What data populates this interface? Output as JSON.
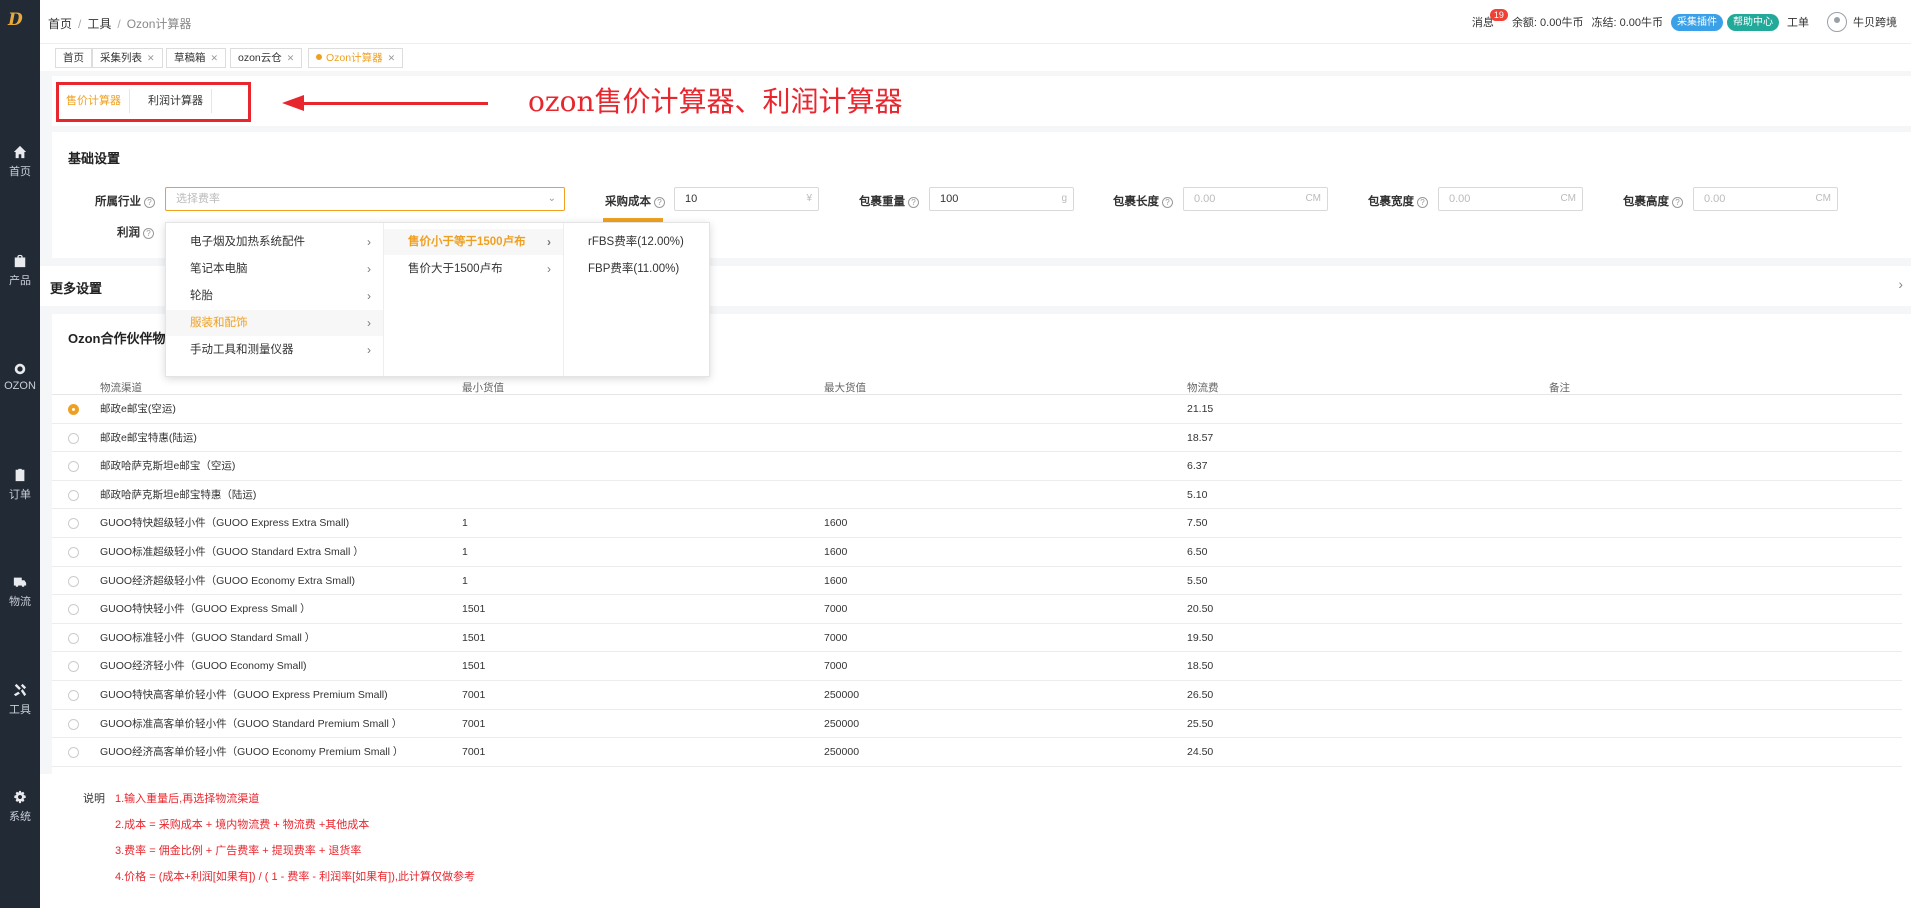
{
  "sidebar": {
    "logo": "D",
    "items": [
      {
        "label": "首页",
        "icon": "home-icon"
      },
      {
        "label": "产品",
        "icon": "bag-icon"
      },
      {
        "label": "OZON",
        "icon": "ozon-icon"
      },
      {
        "label": "订单",
        "icon": "clipboard-icon"
      },
      {
        "label": "物流",
        "icon": "truck-icon"
      },
      {
        "label": "工具",
        "icon": "tools-icon"
      },
      {
        "label": "系统",
        "icon": "gear-icon"
      }
    ]
  },
  "topbar": {
    "breadcrumb": [
      "首页",
      "工具",
      "Ozon计算器"
    ],
    "messages_label": "消息",
    "messages_count": "19",
    "balance": "余额: 0.00牛币",
    "frozen": "冻结: 0.00牛币",
    "plugin_btn": "采集插件",
    "help_btn": "帮助中心",
    "ticket": "工单",
    "username": "牛贝跨境"
  },
  "page_tabs": [
    {
      "label": "首页",
      "closable": false
    },
    {
      "label": "采集列表",
      "closable": true
    },
    {
      "label": "草稿箱",
      "closable": true
    },
    {
      "label": "ozon云仓",
      "closable": true
    },
    {
      "label": "Ozon计算器",
      "closable": true,
      "active": true
    }
  ],
  "sub_tabs": [
    "售价计算器",
    "利润计算器"
  ],
  "annotation": "ozon售价计算器、利润计算器",
  "basic": {
    "title": "基础设置",
    "industry_label": "所属行业",
    "industry_placeholder": "选择费率",
    "purchase_label": "采购成本",
    "purchase_value": "10",
    "purchase_unit": "¥",
    "weight_label": "包裹重量",
    "weight_value": "100",
    "weight_unit": "g",
    "length_label": "包裹长度",
    "length_placeholder": "0.00",
    "width_label": "包裹宽度",
    "width_placeholder": "0.00",
    "height_label": "包裹高度",
    "height_placeholder": "0.00",
    "dim_unit": "CM",
    "profit_label": "利润"
  },
  "cascader": {
    "col1": [
      "电子烟及加热系统配件",
      "笔记本电脑",
      "轮胎",
      "服装和配饰",
      "手动工具和测量仪器"
    ],
    "col1_selected": 3,
    "col2": [
      "售价小于等于1500卢布",
      "售价大于1500卢布"
    ],
    "col2_selected": 0,
    "col3": [
      "rFBS费率(12.00%)",
      "FBP费率(11.00%)"
    ]
  },
  "more_settings": "更多设置",
  "logistics": {
    "title": "Ozon合作伙伴物",
    "headers": [
      "物流渠道",
      "最小货值",
      "最大货值",
      "物流费",
      "备注"
    ],
    "rows": [
      {
        "name": "邮政e邮宝(空运)",
        "min": "",
        "max": "",
        "fee": "21.15",
        "selected": true
      },
      {
        "name": "邮政e邮宝特惠(陆运)",
        "min": "",
        "max": "",
        "fee": "18.57"
      },
      {
        "name": "邮政哈萨克斯坦e邮宝（空运)",
        "min": "",
        "max": "",
        "fee": "6.37"
      },
      {
        "name": "邮政哈萨克斯坦e邮宝特惠（陆运)",
        "min": "",
        "max": "",
        "fee": "5.10"
      },
      {
        "name": "GUOO特快超级轻小件（GUOO Express Extra Small)",
        "min": "1",
        "max": "1600",
        "fee": "7.50"
      },
      {
        "name": "GUOO标准超级轻小件（GUOO Standard Extra Small ）",
        "min": "1",
        "max": "1600",
        "fee": "6.50"
      },
      {
        "name": "GUOO经济超级轻小件（GUOO Economy Extra Small)",
        "min": "1",
        "max": "1600",
        "fee": "5.50"
      },
      {
        "name": "GUOO特快轻小件（GUOO Express Small ）",
        "min": "1501",
        "max": "7000",
        "fee": "20.50"
      },
      {
        "name": "GUOO标准轻小件（GUOO Standard Small ）",
        "min": "1501",
        "max": "7000",
        "fee": "19.50"
      },
      {
        "name": "GUOO经济轻小件（GUOO Economy Small)",
        "min": "1501",
        "max": "7000",
        "fee": "18.50"
      },
      {
        "name": "GUOO特快高客单价轻小件（GUOO Express Premium Small)",
        "min": "7001",
        "max": "250000",
        "fee": "26.50"
      },
      {
        "name": "GUOO标准高客单价轻小件（GUOO Standard Premium Small ）",
        "min": "7001",
        "max": "250000",
        "fee": "25.50"
      },
      {
        "name": "GUOO经济高客单价轻小件（GUOO Economy Premium Small ）",
        "min": "7001",
        "max": "250000",
        "fee": "24.50"
      }
    ]
  },
  "notes": {
    "label": "说明",
    "lines": [
      "1.输入重量后,再选择物流渠道",
      "2.成本 = 采购成本 + 境内物流费 + 物流费 +其他成本",
      "3.费率 = 佣金比例 + 广告费率 + 提现费率 + 退货率",
      "4.价格 = (成本+利润[如果有]) / ( 1 - 费率 - 利润率[如果有]),此计算仅做参考"
    ]
  },
  "colors": {
    "accent": "#f0a020",
    "sidebar": "#222a36",
    "annotation": "#e8262e"
  }
}
